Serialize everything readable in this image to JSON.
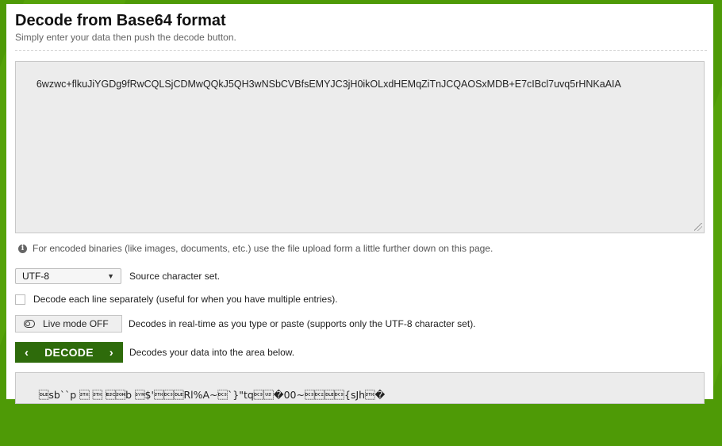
{
  "page": {
    "title": "Decode from Base64 format",
    "subtitle": "Simply enter your data then push the decode button."
  },
  "input": {
    "value": "6wzwc+flkuJiYGDg9fRwCQLSjCDMwQQkJ5QH3wNSbCVBfsEMYJC3jH0ikOLxdHEMqZiTnJCQAOSxMDB+E7cIBcl7uvq5rHNKaAIA"
  },
  "note": {
    "icon": "info-icon",
    "text": "For encoded binaries (like images, documents, etc.) use the file upload form a little further down on this page."
  },
  "charset": {
    "selected": "UTF-8",
    "label": "Source character set."
  },
  "each_line": {
    "label": "Decode each line separately (useful for when you have multiple entries).",
    "checked": false
  },
  "live_mode": {
    "button_label": "Live mode OFF",
    "description": "Decodes in real-time as you type or paste (supports only the UTF-8 character set)."
  },
  "decode": {
    "button_label": "DECODE",
    "description": "Decodes your data into the area below."
  },
  "output": {
    "value": "\u0010sb``p \u0002 \u0002 \u001b\u0001b \u0016$'\u0002\u0013\u0010Rl%A~\u0013`}\"tq\u0013\u001f�00~\u0013\u0012\u0010\u0013{sJh\u0002�"
  },
  "colors": {
    "background": "#4e9a06",
    "button": "#2e6b0b"
  }
}
